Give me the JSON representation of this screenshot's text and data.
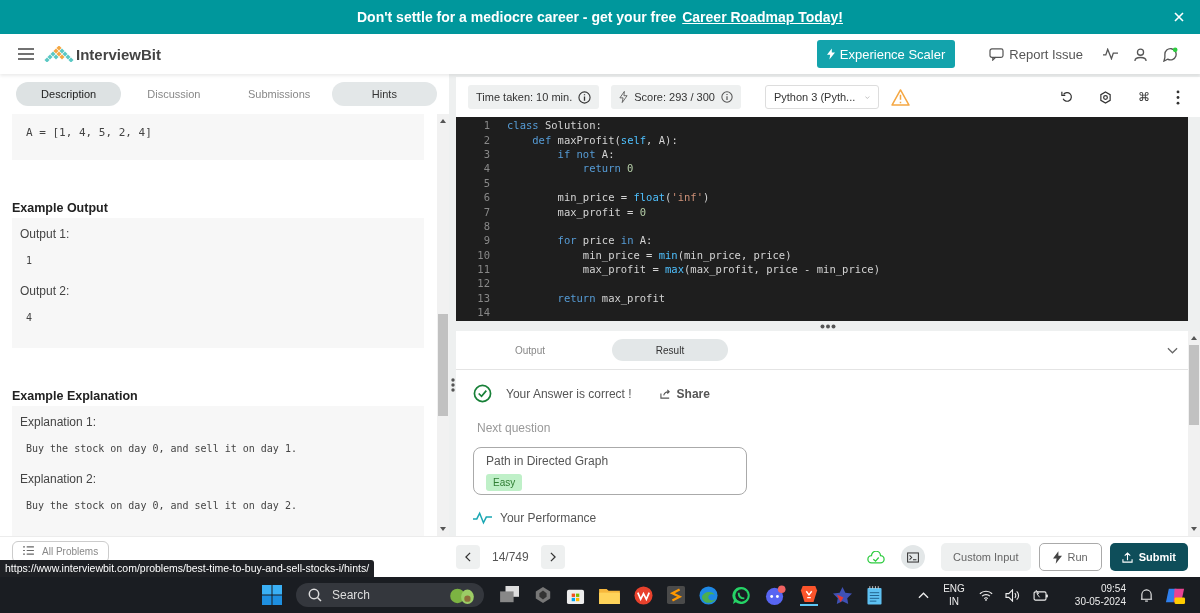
{
  "banner": {
    "text": "Don't settle for a mediocre career - get your free",
    "link": "Career Roadmap Today!"
  },
  "header": {
    "brand": "InterviewBit",
    "cta": "Experience Scaler",
    "report": "Report Issue"
  },
  "problem_tabs": [
    {
      "label": "Description",
      "selected": true,
      "hovered": false
    },
    {
      "label": "Discussion",
      "selected": false,
      "hovered": false
    },
    {
      "label": "Submissions",
      "selected": false,
      "hovered": false
    },
    {
      "label": "Hints",
      "selected": false,
      "hovered": true
    }
  ],
  "description": {
    "input_code": "A = [1, 4, 5, 2, 4]",
    "sections": [
      {
        "heading": "Example Output",
        "items": [
          {
            "label": "Output 1:",
            "code": "1"
          },
          {
            "label": "Output 2:",
            "code": "4"
          }
        ]
      },
      {
        "heading": "Example Explanation",
        "items": [
          {
            "label": "Explanation 1:",
            "code": "Buy the stock on day 0, and sell it on day 1."
          },
          {
            "label": "Explanation 2:",
            "code": "Buy the stock on day 0, and sell it on day 2."
          }
        ]
      }
    ]
  },
  "editor_toolbar": {
    "time_taken": "Time taken: 10 min.",
    "score": "Score: 293 / 300",
    "language": "Python 3 (Pyth...",
    "shortcut_key": "⌘"
  },
  "code_lines": [
    {
      "number": "1",
      "tokens": [
        {
          "kind": "keyword",
          "text": "class"
        },
        {
          "kind": "plain",
          "text": " Solution:"
        }
      ]
    },
    {
      "number": "2",
      "tokens": [
        {
          "kind": "keyword",
          "text": "    def"
        },
        {
          "kind": "plain",
          "text": " maxProfit("
        },
        {
          "kind": "builtin",
          "text": "self"
        },
        {
          "kind": "plain",
          "text": ", A):"
        }
      ]
    },
    {
      "number": "3",
      "tokens": [
        {
          "kind": "keyword",
          "text": "        if not"
        },
        {
          "kind": "plain",
          "text": " A:"
        }
      ]
    },
    {
      "number": "4",
      "tokens": [
        {
          "kind": "keyword",
          "text": "            return"
        },
        {
          "kind": "number",
          "text": " 0"
        }
      ]
    },
    {
      "number": "5"
    },
    {
      "number": "6",
      "tokens": [
        {
          "kind": "plain",
          "text": "        min_price = "
        },
        {
          "kind": "builtin",
          "text": "float"
        },
        {
          "kind": "plain",
          "text": "("
        },
        {
          "kind": "string",
          "text": "'inf'"
        },
        {
          "kind": "plain",
          "text": ")"
        }
      ]
    },
    {
      "number": "7",
      "tokens": [
        {
          "kind": "plain",
          "text": "        max_profit = "
        },
        {
          "kind": "number",
          "text": "0"
        }
      ]
    },
    {
      "number": "8"
    },
    {
      "number": "9",
      "tokens": [
        {
          "kind": "keyword",
          "text": "        for"
        },
        {
          "kind": "plain",
          "text": " price "
        },
        {
          "kind": "keyword",
          "text": "in"
        },
        {
          "kind": "plain",
          "text": " A:"
        }
      ]
    },
    {
      "number": "10",
      "tokens": [
        {
          "kind": "plain",
          "text": "            min_price = "
        },
        {
          "kind": "builtin",
          "text": "min"
        },
        {
          "kind": "plain",
          "text": "(min_price, price)"
        }
      ]
    },
    {
      "number": "11",
      "tokens": [
        {
          "kind": "plain",
          "text": "            max_profit = "
        },
        {
          "kind": "builtin",
          "text": "max"
        },
        {
          "kind": "plain",
          "text": "(max_profit, price - min_price)"
        }
      ]
    },
    {
      "number": "12"
    },
    {
      "number": "13",
      "tokens": [
        {
          "kind": "keyword",
          "text": "        return"
        },
        {
          "kind": "plain",
          "text": " max_profit"
        }
      ]
    },
    {
      "number": "14"
    }
  ],
  "result_tabs": [
    {
      "label": "Output",
      "selected": false
    },
    {
      "label": "Result",
      "selected": true
    }
  ],
  "result": {
    "message": "Your Answer is correct !",
    "share": "Share",
    "next_label": "Next question",
    "next_problem": {
      "title": "Path in Directed Graph",
      "difficulty": "Easy"
    },
    "performance": "Your Performance"
  },
  "footer": {
    "all_problems": "All Problems",
    "counter": "14/749",
    "custom_input": "Custom Input",
    "run": "Run",
    "submit": "Submit"
  },
  "status_url": "https://www.interviewbit.com/problems/best-time-to-buy-and-sell-stocks-i/hints/",
  "taskbar": {
    "search": "Search",
    "language": "ENG",
    "region": "IN",
    "time": "09:54",
    "date": "30-05-2024"
  }
}
